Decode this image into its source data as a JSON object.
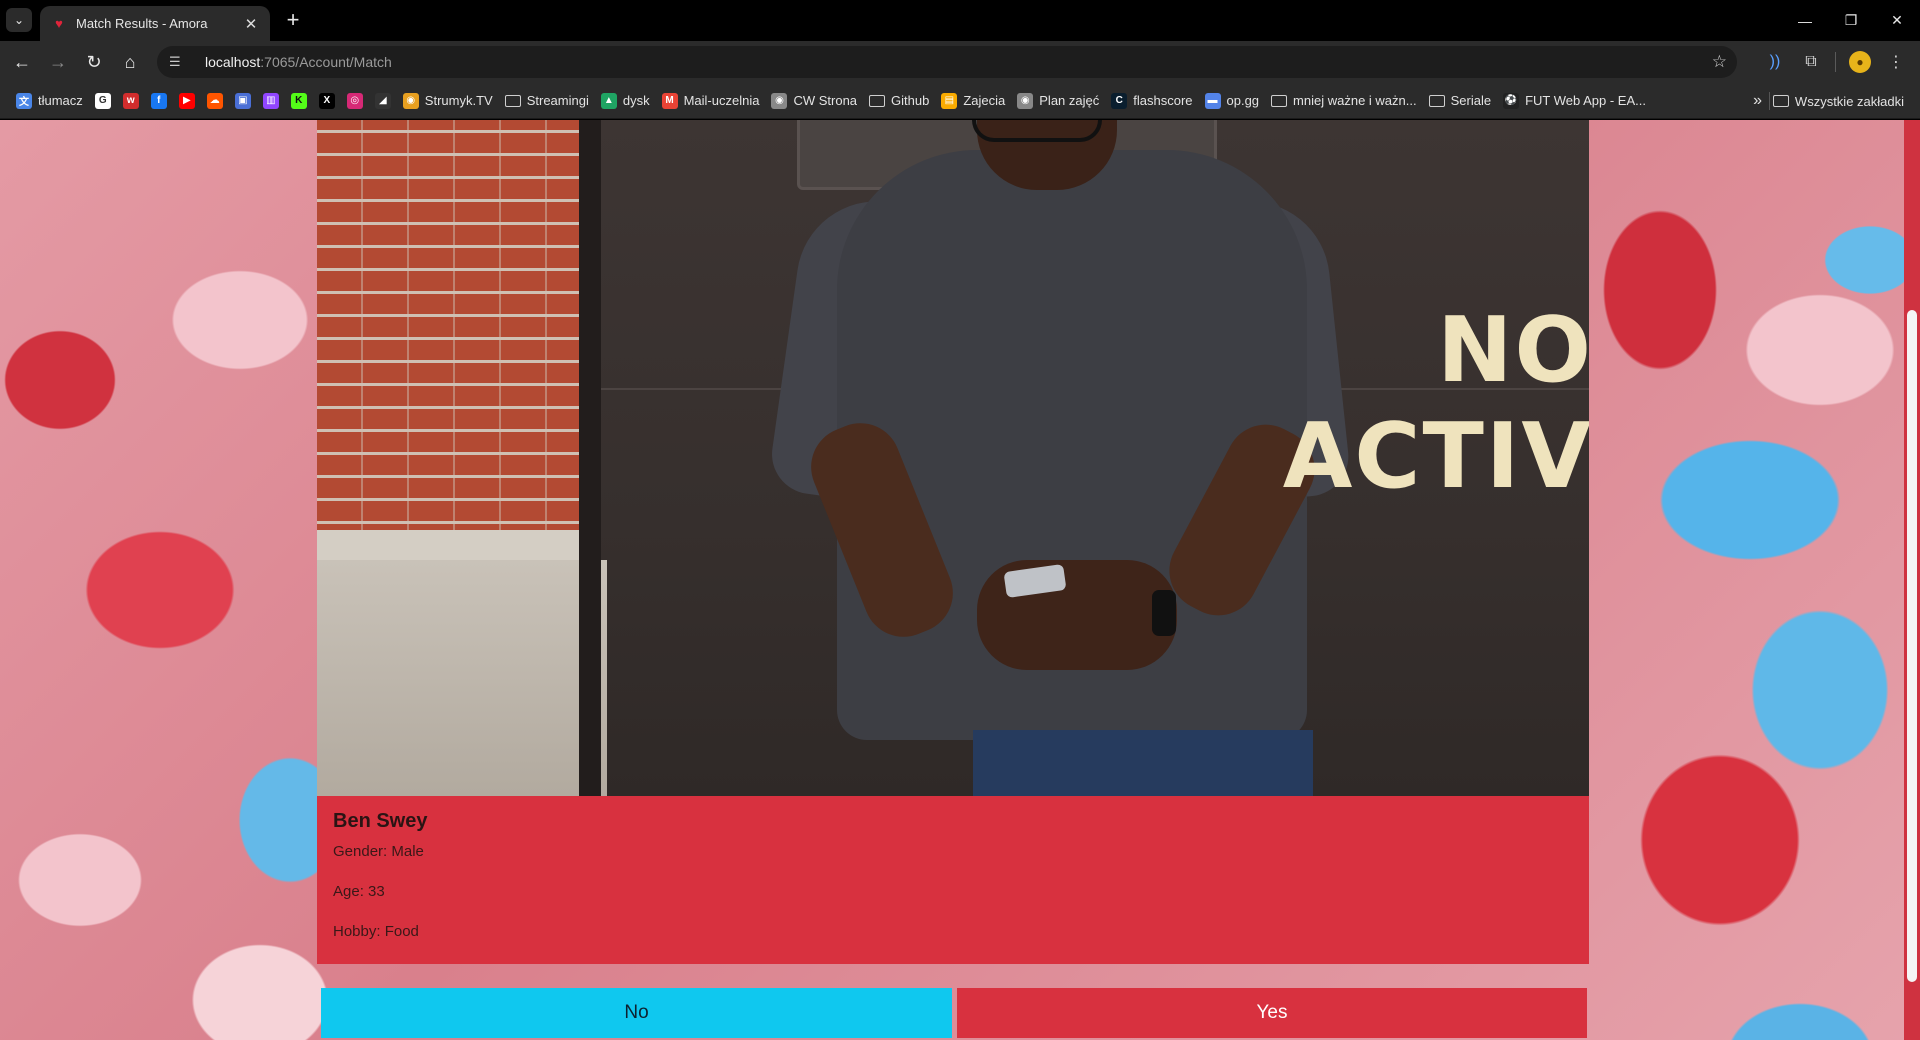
{
  "browser": {
    "tab_title": "Match Results - Amora",
    "url_host": "localhost",
    "url_path": ":7065/Account/Match",
    "bookmarks": [
      {
        "label": "tłumacz",
        "icon": "translate-icon",
        "color": "#4a86e8"
      },
      {
        "label": "",
        "icon": "google-icon",
        "color": "#ffffff"
      },
      {
        "label": "",
        "icon": "wykop-icon",
        "color": "#d22d2d"
      },
      {
        "label": "",
        "icon": "facebook-icon",
        "color": "#1877f2"
      },
      {
        "label": "",
        "icon": "youtube-icon",
        "color": "#ff0000"
      },
      {
        "label": "",
        "icon": "soundcloud-icon",
        "color": "#ff5500"
      },
      {
        "label": "",
        "icon": "bookmark-app-icon",
        "color": "#4a6fd6"
      },
      {
        "label": "",
        "icon": "twitch-icon",
        "color": "#9146ff"
      },
      {
        "label": "",
        "icon": "kick-icon",
        "color": "#53fc18"
      },
      {
        "label": "",
        "icon": "x-icon",
        "color": "#000000"
      },
      {
        "label": "",
        "icon": "instagram-icon",
        "color": "#d62976"
      },
      {
        "label": "",
        "icon": "steam-icon",
        "color": "#333333"
      },
      {
        "label": "Strumyk.TV",
        "icon": "globe-icon",
        "color": "#e8a020"
      },
      {
        "label": "Streamingi",
        "icon": "folder-icon",
        "color": ""
      },
      {
        "label": "dysk",
        "icon": "drive-icon",
        "color": "#1fa463"
      },
      {
        "label": "Mail-uczelnia",
        "icon": "gmail-icon",
        "color": "#ea4335"
      },
      {
        "label": "CW Strona",
        "icon": "globe-icon",
        "color": "#888888"
      },
      {
        "label": "Github",
        "icon": "folder-icon",
        "color": ""
      },
      {
        "label": "Zajecia",
        "icon": "classroom-icon",
        "color": "#f9ab00"
      },
      {
        "label": "Plan zajęć",
        "icon": "globe-icon",
        "color": "#888888"
      },
      {
        "label": "flashscore",
        "icon": "flashscore-icon",
        "color": "#0a1e2e"
      },
      {
        "label": "op.gg",
        "icon": "opgg-icon",
        "color": "#5383e8"
      },
      {
        "label": "mniej ważne i ważn...",
        "icon": "folder-icon",
        "color": ""
      },
      {
        "label": "Seriale",
        "icon": "folder-icon",
        "color": ""
      },
      {
        "label": "FUT Web App - EA...",
        "icon": "ea-icon",
        "color": "#222222"
      }
    ],
    "all_bookmarks_label": "Wszystkie zakładki"
  },
  "match": {
    "name": "Ben Swey",
    "gender_line": "Gender: Male",
    "age_line": "Age: 33",
    "hobby_line": "Hobby: Food",
    "photo_sign_line1": "NO",
    "photo_sign_line2": "ACTIV"
  },
  "actions": {
    "no_label": "No",
    "yes_label": "Yes"
  },
  "colors": {
    "accent_red": "#d8313f",
    "accent_cyan": "#0fc8ef"
  }
}
